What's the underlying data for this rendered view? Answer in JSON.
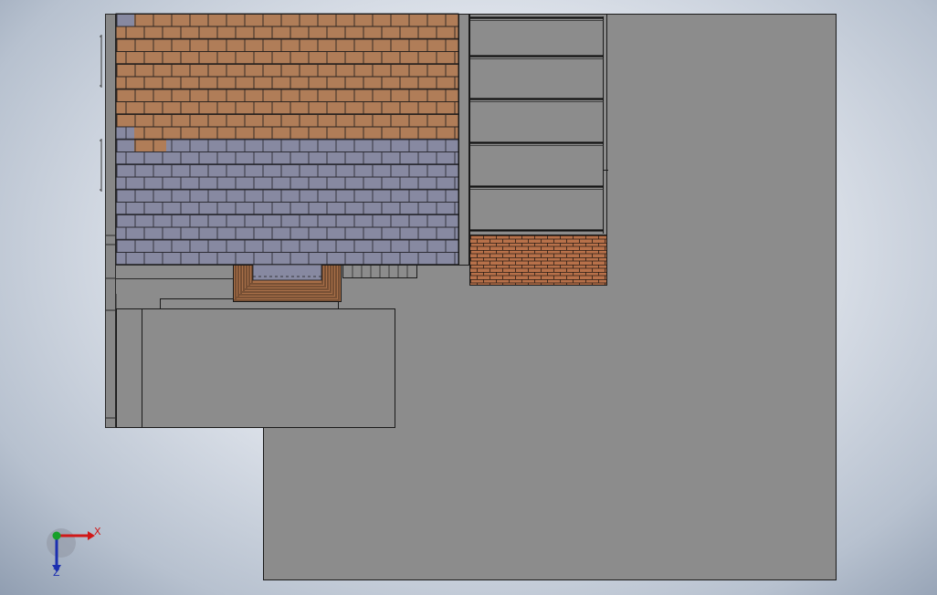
{
  "viewport": {
    "background": "#dfe4eb",
    "model_gray": "#8c8c8c",
    "model_outline": "#1a1a1a",
    "slate_color": "#8789a1",
    "clay_color": "#b07d58",
    "brick_color": "#b8714a"
  },
  "triad": {
    "x_label": "X",
    "z_label": "Z",
    "x_color": "#d01818",
    "y_color": "#16a02a",
    "z_color": "#1c2fb0"
  }
}
